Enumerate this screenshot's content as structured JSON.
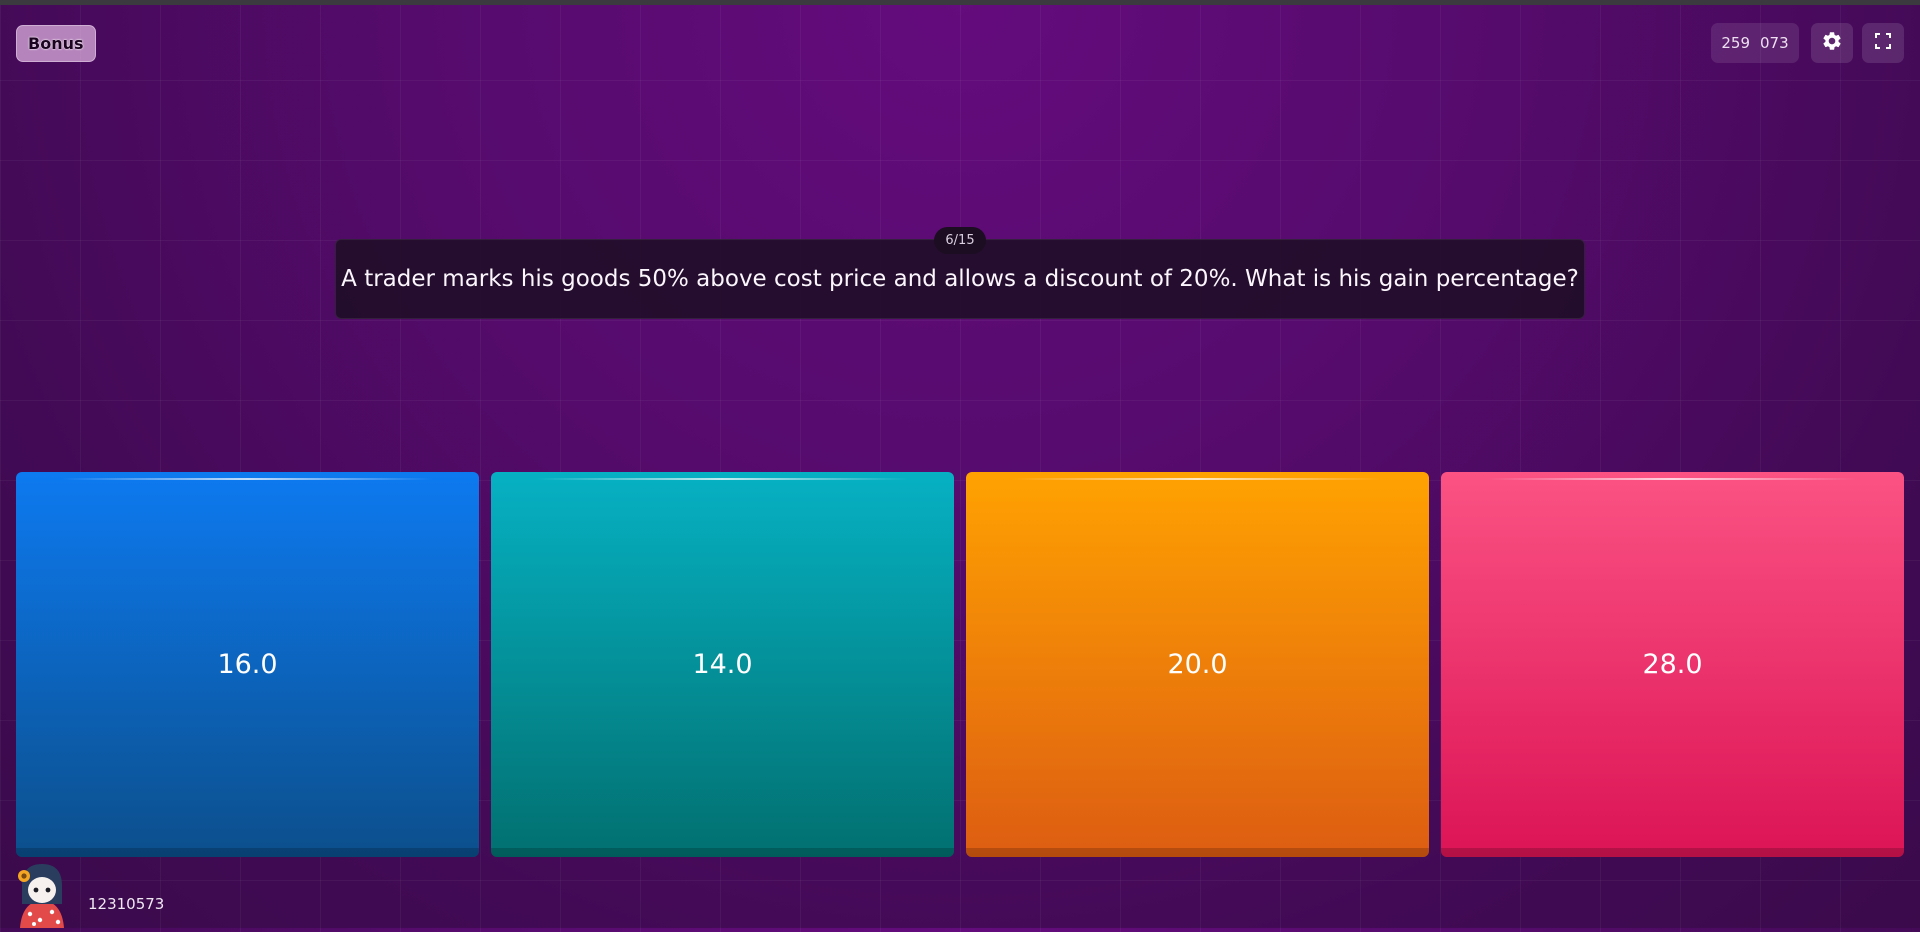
{
  "header": {
    "bonus_label": "Bonus",
    "score_left": "259",
    "score_right": "073",
    "settings_icon": "gear-icon",
    "fullscreen_icon": "fullscreen-icon"
  },
  "question": {
    "counter": "6/15",
    "text": "A trader marks his goods 50% above cost price and allows a discount of 20%. What is his gain percentage?"
  },
  "answers": [
    {
      "label": "16.0",
      "color": "#0d6fdc"
    },
    {
      "label": "14.0",
      "color": "#04a0ad"
    },
    {
      "label": "20.0",
      "color": "#f7930a"
    },
    {
      "label": "28.0",
      "color": "#f23a72"
    }
  ],
  "player": {
    "id": "12310573",
    "avatar_icon": "avatar-icon"
  }
}
